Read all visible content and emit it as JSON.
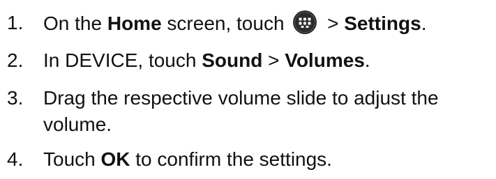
{
  "steps": [
    {
      "number": "1.",
      "parts": {
        "a": "On the ",
        "b": "Home",
        "c": " screen, touch ",
        "d": " > ",
        "e": "Settings",
        "f": "."
      },
      "icon": "apps-grid-icon"
    },
    {
      "number": "2.",
      "parts": {
        "a": "In DEVICE, touch ",
        "b": "Sound",
        "c": " > ",
        "d": "Volumes",
        "e": "."
      }
    },
    {
      "number": "3.",
      "text": "Drag the respective volume slide to adjust the volume."
    },
    {
      "number": "4.",
      "parts": {
        "a": "Touch ",
        "b": "OK",
        "c": " to confirm the settings."
      }
    }
  ],
  "colors": {
    "text": "#111111",
    "icon_bg": "#2b2b2b",
    "icon_dots": "#ffffff"
  }
}
